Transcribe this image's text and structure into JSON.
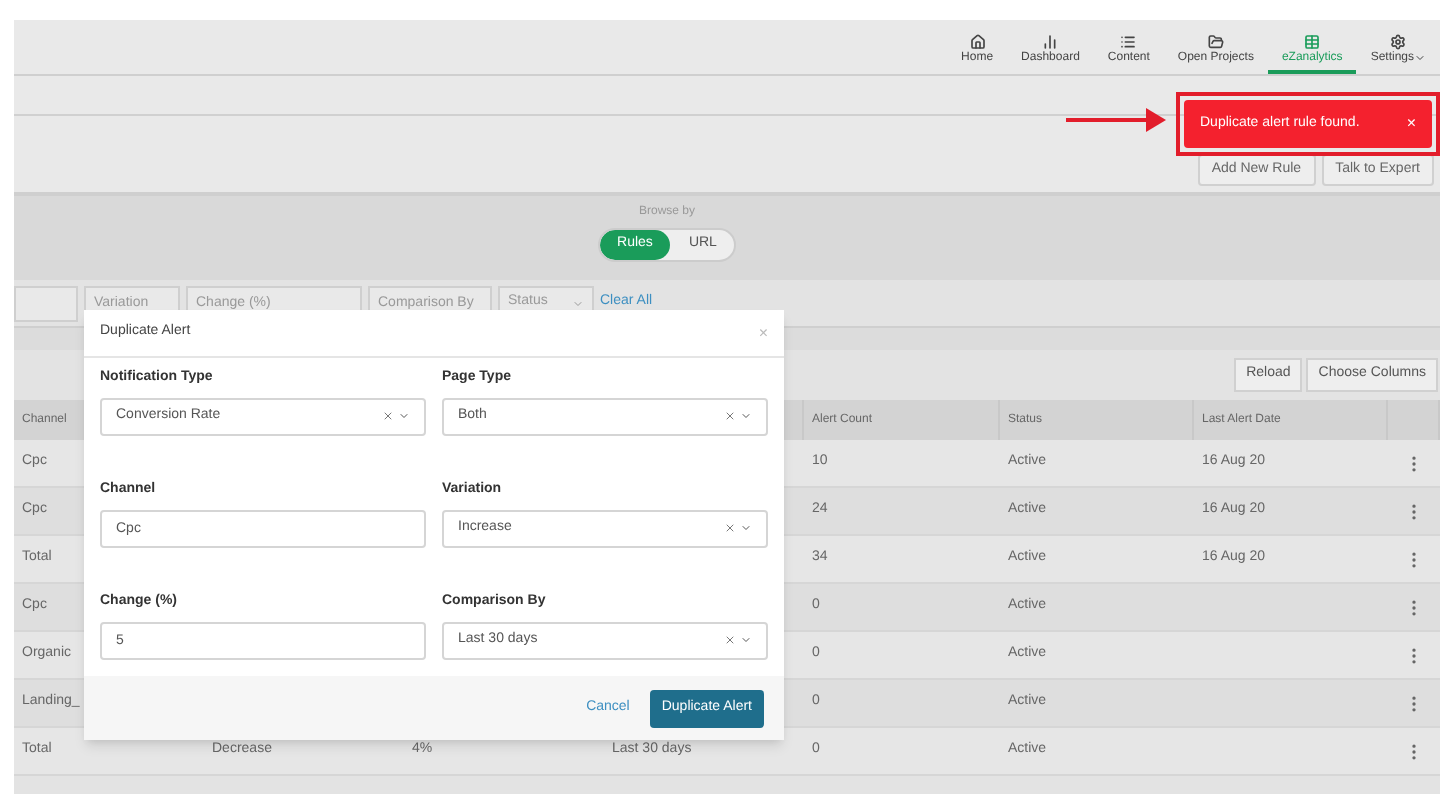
{
  "nav": [
    {
      "label": "Home",
      "selected": false
    },
    {
      "label": "Dashboard",
      "selected": false
    },
    {
      "label": "Content",
      "selected": false
    },
    {
      "label": "Open Projects",
      "selected": false
    },
    {
      "label": "eZanalytics",
      "selected": true
    },
    {
      "label": "Settings",
      "selected": false,
      "caret": true
    }
  ],
  "toast": {
    "message": "Duplicate alert rule found.",
    "close": "×"
  },
  "header_buttons": [
    "Add New Rule",
    "Talk to Expert"
  ],
  "browse": {
    "label": "Browse by",
    "options": [
      {
        "label": "Rules",
        "selected": true
      },
      {
        "label": "URL",
        "selected": false
      }
    ]
  },
  "filters": [
    {
      "kind": "input"
    },
    {
      "placeholder": "Variation",
      "kind": "input"
    },
    {
      "placeholder": "Change (%)",
      "kind": "input"
    },
    {
      "placeholder": "Comparison By",
      "kind": "input"
    },
    {
      "placeholder": "Status",
      "kind": "select"
    }
  ],
  "clear_all": "Clear All",
  "table_buttons": [
    "Reload",
    "Choose Columns"
  ],
  "table": {
    "columns": {
      "channel": "Channel",
      "alert_count": "Alert Count",
      "status": "Status",
      "last_alert_date": "Last Alert Date"
    },
    "rows": [
      {
        "channel": "Cpc",
        "alert_count": "10",
        "status": "Active",
        "last_alert_date": "16 Aug 20"
      },
      {
        "channel": "Cpc",
        "alert_count": "24",
        "status": "Active",
        "last_alert_date": "16 Aug 20"
      },
      {
        "channel": "Total",
        "alert_count": "34",
        "status": "Active",
        "last_alert_date": "16 Aug 20"
      },
      {
        "channel": "Cpc",
        "alert_count": "0",
        "status": "Active"
      },
      {
        "channel": "Organic",
        "alert_count": "0",
        "status": "Active"
      },
      {
        "channel": "Landing_",
        "alert_count": "0",
        "status": "Active"
      },
      {
        "channel": "Total",
        "column_2": "Decrease",
        "column_3": "4%",
        "column_4": "Last 30 days",
        "alert_count": "0",
        "status": "Active"
      }
    ]
  },
  "modal": {
    "title": "Duplicate Alert",
    "close": "×",
    "fields": [
      {
        "label": "Notification Type",
        "value": "Conversion Rate",
        "kind": "select"
      },
      {
        "label": "Page Type",
        "value": "Both",
        "kind": "select"
      },
      {
        "label": "Channel",
        "value": "Cpc",
        "kind": "input"
      },
      {
        "label": "Variation",
        "value": "Increase",
        "kind": "select"
      },
      {
        "label": "Change (%)",
        "value": "5",
        "kind": "input"
      },
      {
        "label": "Comparison By",
        "value": "Last 30 days",
        "kind": "select"
      }
    ],
    "cancel": "Cancel",
    "submit": "Duplicate Alert"
  }
}
